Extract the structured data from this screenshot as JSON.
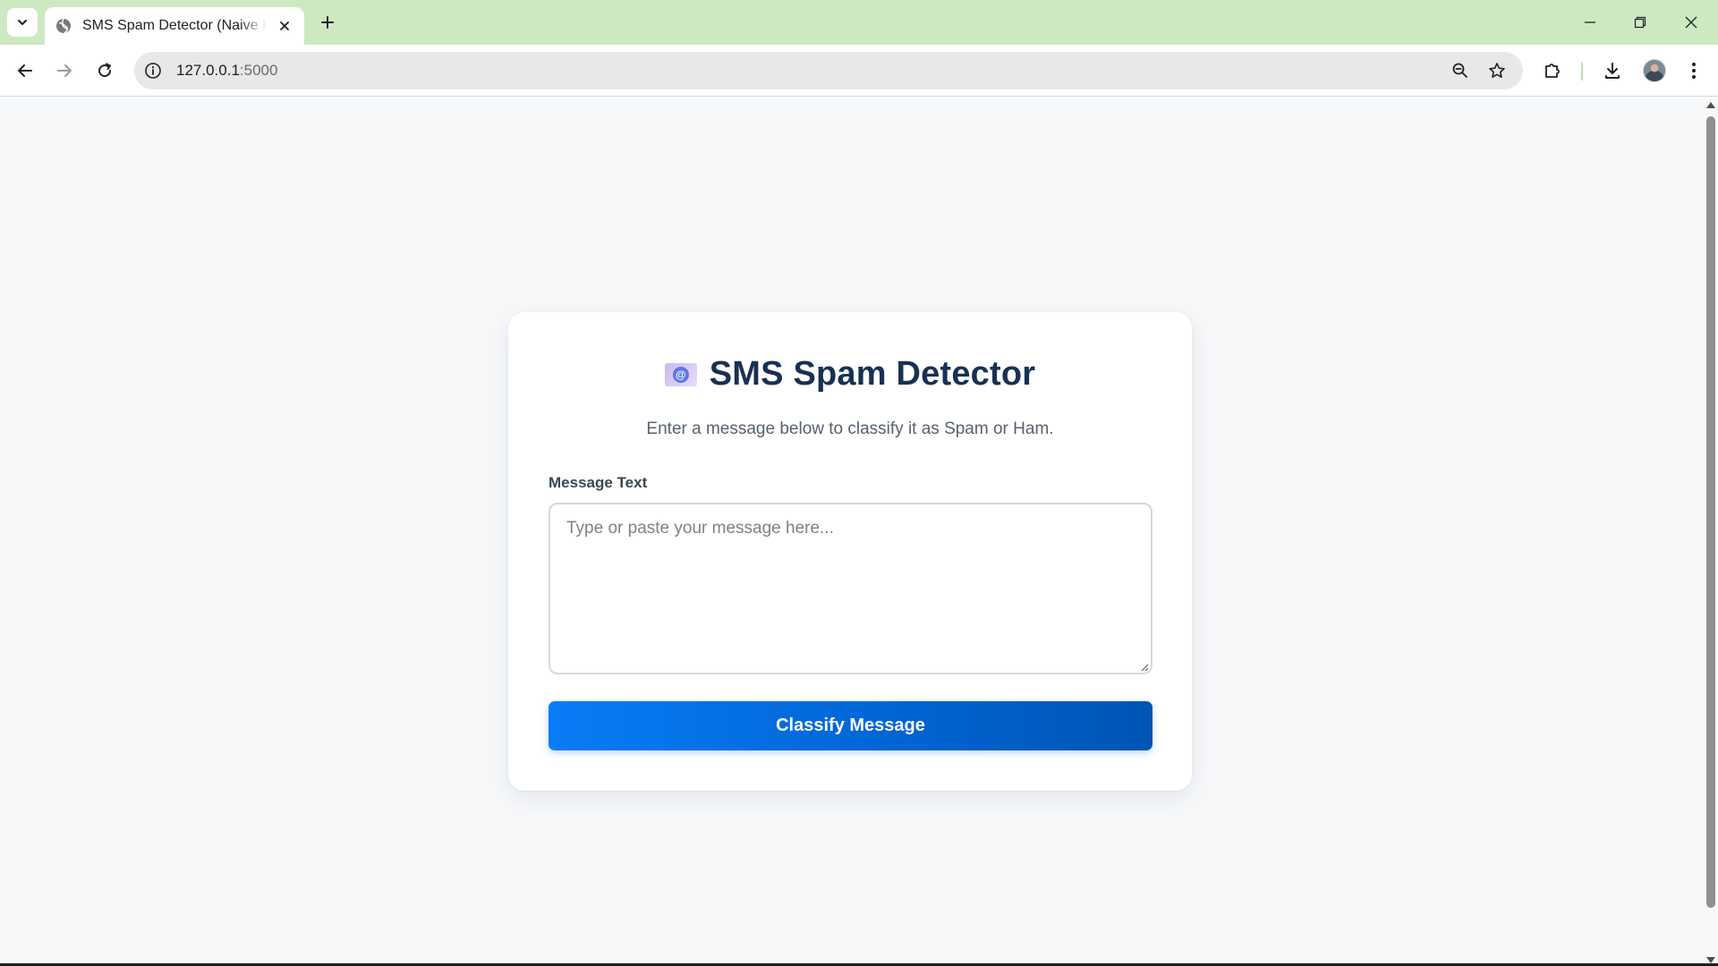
{
  "browser": {
    "tab_title": "SMS Spam Detector (Naive Bayes)",
    "url_host": "127.0.0.1",
    "url_port": ":5000"
  },
  "icons": {
    "tab_search": "chevron-down-icon",
    "favicon": "globe-icon",
    "tab_close": "close-icon",
    "new_tab": "plus-icon",
    "minimize": "minimize-icon",
    "restore": "restore-icon",
    "close_window": "close-icon",
    "back": "arrow-left-icon",
    "forward": "arrow-right-icon",
    "reload": "reload-icon",
    "site_info": "info-icon",
    "zoom": "zoom-icon",
    "bookmark": "star-icon",
    "extensions": "puzzle-icon",
    "downloads": "download-icon",
    "menu": "kebab-menu-icon",
    "title_emoji": "email-at-icon"
  },
  "page": {
    "title": "SMS Spam Detector",
    "subtitle": "Enter a message below to classify it as Spam or Ham.",
    "message_label": "Message Text",
    "message_value": "",
    "message_placeholder": "Type or paste your message here...",
    "classify_button": "Classify Message"
  },
  "colors": {
    "tabstrip": "#cde9c2",
    "title": "#183153",
    "button_start": "#0a7cf6",
    "button_end": "#0055b4"
  }
}
